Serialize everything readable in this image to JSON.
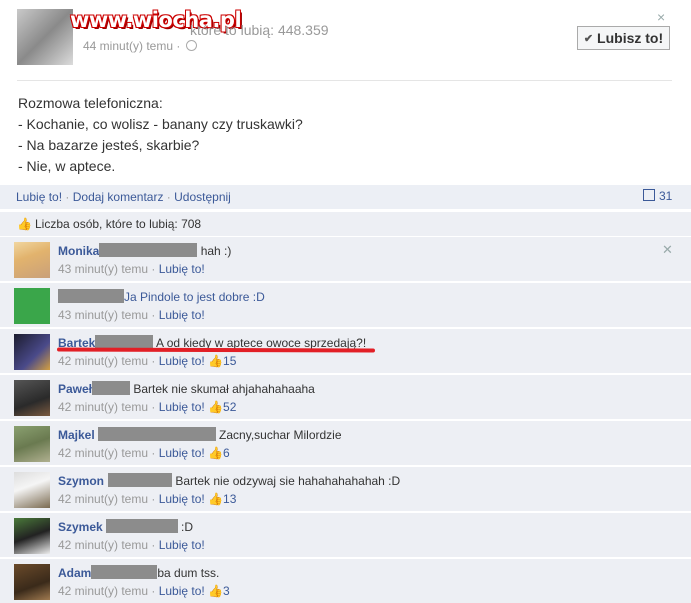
{
  "header": {
    "watermark": "www.wiocha.pl",
    "likes_text": "które to lubią: 448.359",
    "time": "44 minut(y) temu ·",
    "close": "×",
    "like_button_check": "✔",
    "like_button": "Lubisz to!"
  },
  "post": {
    "lines": [
      "Rozmowa telefoniczna:",
      "- Kochanie, co wolisz - banany czy truskawki?",
      "- Na bazarze jesteś, skarbie?",
      "- Nie, w aptece."
    ]
  },
  "actions": {
    "like": "Lubię to!",
    "comment": "Dodaj komentarz",
    "share": "Udostępnij",
    "comments_count": "31"
  },
  "likes_row": {
    "icon": "thumbs-up-icon",
    "text": "Liczba osób, które to lubią: 708"
  },
  "comments": [
    {
      "name": "Monika",
      "text": "hah :)",
      "time": "43 minut(y) temu ·",
      "like": "Lubię to!",
      "like_count": ""
    },
    {
      "name": "",
      "text": "Ja Pindole to jest dobre :D",
      "time": "43 minut(y) temu ·",
      "like": "Lubię to!",
      "like_count": ""
    },
    {
      "name": "Bartek",
      "text": "A od kiedy w aptece owoce sprzedają?!",
      "time": "42 minut(y) temu ·",
      "like": "Lubię to!",
      "like_count": "15"
    },
    {
      "name": "Paweł",
      "text": "Bartek nie skumał ahjahahahaaha",
      "time": "42 minut(y) temu ·",
      "like": "Lubię to!",
      "like_count": "52"
    },
    {
      "name": "Majkel",
      "text": "Zacny,suchar Milordzie",
      "time": "42 minut(y) temu ·",
      "like": "Lubię to!",
      "like_count": "6"
    },
    {
      "name": "Szymon",
      "text": "Bartek nie odzywaj sie hahahahahahah :D",
      "time": "42 minut(y) temu ·",
      "like": "Lubię to!",
      "like_count": "13"
    },
    {
      "name": "Szymek",
      "text": ":D",
      "time": "42 minut(y) temu ·",
      "like": "Lubię to!",
      "like_count": ""
    },
    {
      "name": "Adam",
      "text": "ba dum tss.",
      "time": "42 minut(y) temu ·",
      "like": "Lubię to!",
      "like_count": "3"
    }
  ],
  "colors": {
    "link": "#3b5998",
    "highlight": "#e21f26",
    "panel": "#edeff4"
  }
}
